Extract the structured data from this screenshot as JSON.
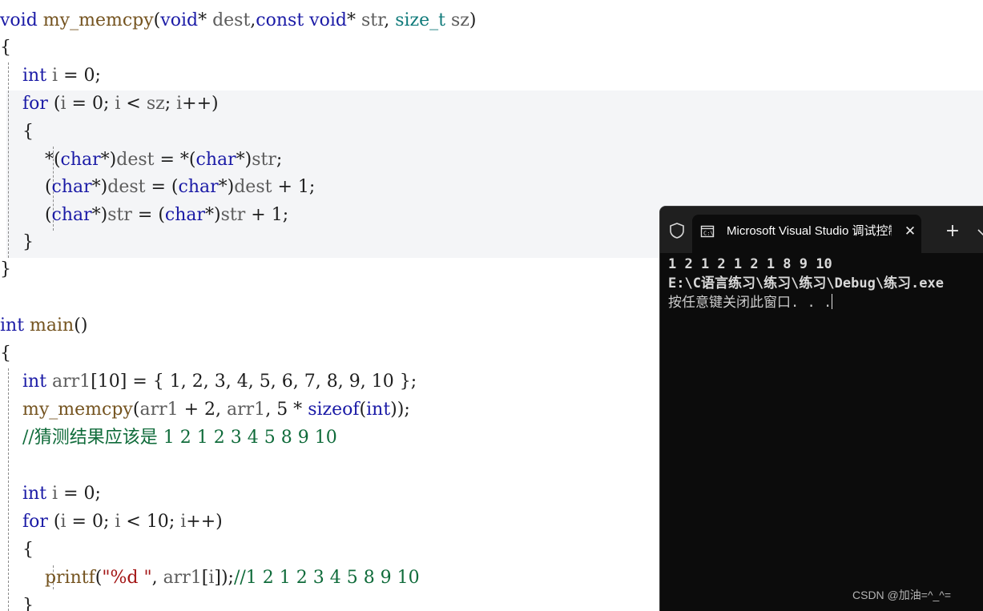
{
  "editor": {
    "lines": [
      {
        "tokens": [
          {
            "t": "void",
            "c": "kw"
          },
          {
            "t": " ",
            "c": "punc"
          },
          {
            "t": "my_memcpy",
            "c": "fn"
          },
          {
            "t": "(",
            "c": "punc"
          },
          {
            "t": "void",
            "c": "kw"
          },
          {
            "t": "* ",
            "c": "punc"
          },
          {
            "t": "dest",
            "c": "var"
          },
          {
            "t": ",",
            "c": "punc"
          },
          {
            "t": "const",
            "c": "kw"
          },
          {
            "t": " ",
            "c": "punc"
          },
          {
            "t": "void",
            "c": "kw"
          },
          {
            "t": "* ",
            "c": "punc"
          },
          {
            "t": "str",
            "c": "var"
          },
          {
            "t": ", ",
            "c": "punc"
          },
          {
            "t": "size_t",
            "c": "type"
          },
          {
            "t": " ",
            "c": "punc"
          },
          {
            "t": "sz",
            "c": "var"
          },
          {
            "t": ")",
            "c": "punc"
          }
        ]
      },
      {
        "tokens": [
          {
            "t": "{",
            "c": "punc"
          }
        ]
      },
      {
        "tokens": [
          {
            "t": "    ",
            "c": "punc"
          },
          {
            "t": "int",
            "c": "kw"
          },
          {
            "t": " ",
            "c": "punc"
          },
          {
            "t": "i",
            "c": "var"
          },
          {
            "t": " = ",
            "c": "punc"
          },
          {
            "t": "0",
            "c": "num"
          },
          {
            "t": ";",
            "c": "punc"
          }
        ]
      },
      {
        "tokens": [
          {
            "t": "    ",
            "c": "punc"
          },
          {
            "t": "for",
            "c": "kw"
          },
          {
            "t": " (",
            "c": "punc"
          },
          {
            "t": "i",
            "c": "var"
          },
          {
            "t": " = ",
            "c": "punc"
          },
          {
            "t": "0",
            "c": "num"
          },
          {
            "t": "; ",
            "c": "punc"
          },
          {
            "t": "i",
            "c": "var"
          },
          {
            "t": " < ",
            "c": "punc"
          },
          {
            "t": "sz",
            "c": "var"
          },
          {
            "t": "; ",
            "c": "punc"
          },
          {
            "t": "i",
            "c": "var"
          },
          {
            "t": "++)",
            "c": "punc"
          }
        ]
      },
      {
        "tokens": [
          {
            "t": "    {",
            "c": "punc"
          }
        ]
      },
      {
        "tokens": [
          {
            "t": "        *(",
            "c": "punc"
          },
          {
            "t": "char",
            "c": "kw"
          },
          {
            "t": "*)",
            "c": "punc"
          },
          {
            "t": "dest",
            "c": "var"
          },
          {
            "t": " = *(",
            "c": "punc"
          },
          {
            "t": "char",
            "c": "kw"
          },
          {
            "t": "*)",
            "c": "punc"
          },
          {
            "t": "str",
            "c": "var"
          },
          {
            "t": ";",
            "c": "punc"
          }
        ]
      },
      {
        "tokens": [
          {
            "t": "        (",
            "c": "punc"
          },
          {
            "t": "char",
            "c": "kw"
          },
          {
            "t": "*)",
            "c": "punc"
          },
          {
            "t": "dest",
            "c": "var"
          },
          {
            "t": " = (",
            "c": "punc"
          },
          {
            "t": "char",
            "c": "kw"
          },
          {
            "t": "*)",
            "c": "punc"
          },
          {
            "t": "dest",
            "c": "var"
          },
          {
            "t": " + ",
            "c": "punc"
          },
          {
            "t": "1",
            "c": "num"
          },
          {
            "t": ";",
            "c": "punc"
          }
        ]
      },
      {
        "tokens": [
          {
            "t": "        (",
            "c": "punc"
          },
          {
            "t": "char",
            "c": "kw"
          },
          {
            "t": "*)",
            "c": "punc"
          },
          {
            "t": "str",
            "c": "var"
          },
          {
            "t": " = (",
            "c": "punc"
          },
          {
            "t": "char",
            "c": "kw"
          },
          {
            "t": "*)",
            "c": "punc"
          },
          {
            "t": "str",
            "c": "var"
          },
          {
            "t": " + ",
            "c": "punc"
          },
          {
            "t": "1",
            "c": "num"
          },
          {
            "t": ";",
            "c": "punc"
          }
        ]
      },
      {
        "tokens": [
          {
            "t": "    }",
            "c": "punc"
          }
        ]
      },
      {
        "tokens": [
          {
            "t": "}",
            "c": "punc"
          }
        ]
      },
      {
        "tokens": []
      },
      {
        "tokens": [
          {
            "t": "int",
            "c": "kw"
          },
          {
            "t": " ",
            "c": "punc"
          },
          {
            "t": "main",
            "c": "fn"
          },
          {
            "t": "()",
            "c": "punc"
          }
        ]
      },
      {
        "tokens": [
          {
            "t": "{",
            "c": "punc"
          }
        ]
      },
      {
        "tokens": [
          {
            "t": "    ",
            "c": "punc"
          },
          {
            "t": "int",
            "c": "kw"
          },
          {
            "t": " ",
            "c": "punc"
          },
          {
            "t": "arr1",
            "c": "var"
          },
          {
            "t": "[",
            "c": "punc"
          },
          {
            "t": "10",
            "c": "num"
          },
          {
            "t": "] = { ",
            "c": "punc"
          },
          {
            "t": "1",
            "c": "num"
          },
          {
            "t": ", ",
            "c": "punc"
          },
          {
            "t": "2",
            "c": "num"
          },
          {
            "t": ", ",
            "c": "punc"
          },
          {
            "t": "3",
            "c": "num"
          },
          {
            "t": ", ",
            "c": "punc"
          },
          {
            "t": "4",
            "c": "num"
          },
          {
            "t": ", ",
            "c": "punc"
          },
          {
            "t": "5",
            "c": "num"
          },
          {
            "t": ", ",
            "c": "punc"
          },
          {
            "t": "6",
            "c": "num"
          },
          {
            "t": ", ",
            "c": "punc"
          },
          {
            "t": "7",
            "c": "num"
          },
          {
            "t": ", ",
            "c": "punc"
          },
          {
            "t": "8",
            "c": "num"
          },
          {
            "t": ", ",
            "c": "punc"
          },
          {
            "t": "9",
            "c": "num"
          },
          {
            "t": ", ",
            "c": "punc"
          },
          {
            "t": "10",
            "c": "num"
          },
          {
            "t": " };",
            "c": "punc"
          }
        ]
      },
      {
        "tokens": [
          {
            "t": "    ",
            "c": "punc"
          },
          {
            "t": "my_memcpy",
            "c": "fn"
          },
          {
            "t": "(",
            "c": "punc"
          },
          {
            "t": "arr1",
            "c": "var"
          },
          {
            "t": " + ",
            "c": "punc"
          },
          {
            "t": "2",
            "c": "num"
          },
          {
            "t": ", ",
            "c": "punc"
          },
          {
            "t": "arr1",
            "c": "var"
          },
          {
            "t": ", ",
            "c": "punc"
          },
          {
            "t": "5",
            "c": "num"
          },
          {
            "t": " * ",
            "c": "punc"
          },
          {
            "t": "sizeof",
            "c": "kw"
          },
          {
            "t": "(",
            "c": "punc"
          },
          {
            "t": "int",
            "c": "kw"
          },
          {
            "t": "));",
            "c": "punc"
          }
        ]
      },
      {
        "tokens": [
          {
            "t": "    ",
            "c": "punc"
          },
          {
            "t": "//猜测结果应该是 1 2 1 2 3 4 5 8 9 10",
            "c": "cmt"
          }
        ]
      },
      {
        "tokens": []
      },
      {
        "tokens": [
          {
            "t": "    ",
            "c": "punc"
          },
          {
            "t": "int",
            "c": "kw"
          },
          {
            "t": " ",
            "c": "punc"
          },
          {
            "t": "i",
            "c": "var"
          },
          {
            "t": " = ",
            "c": "punc"
          },
          {
            "t": "0",
            "c": "num"
          },
          {
            "t": ";",
            "c": "punc"
          }
        ]
      },
      {
        "tokens": [
          {
            "t": "    ",
            "c": "punc"
          },
          {
            "t": "for",
            "c": "kw"
          },
          {
            "t": " (",
            "c": "punc"
          },
          {
            "t": "i",
            "c": "var"
          },
          {
            "t": " = ",
            "c": "punc"
          },
          {
            "t": "0",
            "c": "num"
          },
          {
            "t": "; ",
            "c": "punc"
          },
          {
            "t": "i",
            "c": "var"
          },
          {
            "t": " < ",
            "c": "punc"
          },
          {
            "t": "10",
            "c": "num"
          },
          {
            "t": "; ",
            "c": "punc"
          },
          {
            "t": "i",
            "c": "var"
          },
          {
            "t": "++)",
            "c": "punc"
          }
        ]
      },
      {
        "tokens": [
          {
            "t": "    {",
            "c": "punc"
          }
        ]
      },
      {
        "tokens": [
          {
            "t": "        ",
            "c": "punc"
          },
          {
            "t": "printf",
            "c": "fn"
          },
          {
            "t": "(",
            "c": "punc"
          },
          {
            "t": "\"%d \"",
            "c": "str"
          },
          {
            "t": ", ",
            "c": "punc"
          },
          {
            "t": "arr1",
            "c": "var"
          },
          {
            "t": "[",
            "c": "punc"
          },
          {
            "t": "i",
            "c": "var"
          },
          {
            "t": "]);",
            "c": "punc"
          },
          {
            "t": "//1 2 1 2 3 4 5 8 9 10",
            "c": "cmt"
          }
        ]
      },
      {
        "tokens": [
          {
            "t": "    }",
            "c": "punc"
          }
        ]
      }
    ]
  },
  "console": {
    "tab_title": "Microsoft Visual Studio 调试控制台",
    "output_lines": [
      "1 2 1 2 1 2 1 8 9 10",
      "E:\\C语言练习\\练习\\练习\\Debug\\练习.exe",
      "按任意键关闭此窗口. . ."
    ]
  },
  "watermark": "CSDN @加油=^_^=",
  "colors": {
    "keyword": "#1a1aa6",
    "type": "#0f7a7a",
    "function": "#74531f",
    "variable": "#5c5c5c",
    "string": "#a31515",
    "comment": "#0f6b3a",
    "console_bg": "#0c0c0c",
    "titlebar_bg": "#1f1f1f"
  },
  "icons": {
    "shield": "shield-icon",
    "tab": "console-app-icon",
    "close": "close-icon",
    "add": "plus-icon",
    "dropdown": "chevron-down-icon"
  }
}
